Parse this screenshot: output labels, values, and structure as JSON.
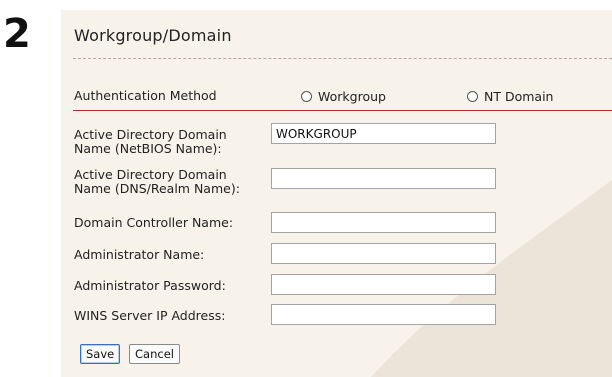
{
  "step": {
    "number": "2"
  },
  "panel": {
    "title": "Workgroup/Domain"
  },
  "auth": {
    "label": "Authentication Method",
    "options": [
      {
        "label": "Workgroup",
        "selected": false
      },
      {
        "label": "NT Domain",
        "selected": false
      }
    ]
  },
  "fields": [
    {
      "label_lines": [
        "Active Directory Domain",
        "Name (NetBIOS Name):"
      ],
      "value": "WORKGROUP"
    },
    {
      "label_lines": [
        "Active Directory Domain",
        "Name (DNS/Realm Name):"
      ],
      "value": ""
    },
    {
      "label_lines": [
        "Domain Controller Name:"
      ],
      "value": ""
    },
    {
      "label_lines": [
        "Administrator Name:"
      ],
      "value": ""
    },
    {
      "label_lines": [
        "Administrator Password:"
      ],
      "value": ""
    },
    {
      "label_lines": [
        "WINS Server IP Address:"
      ],
      "value": ""
    }
  ],
  "buttons": {
    "save_label": "Save",
    "cancel_label": "Cancel"
  },
  "colors": {
    "panel_bg": "#f7f2ea",
    "swoosh": "#ece4d8",
    "divider": "#b22a2a"
  }
}
